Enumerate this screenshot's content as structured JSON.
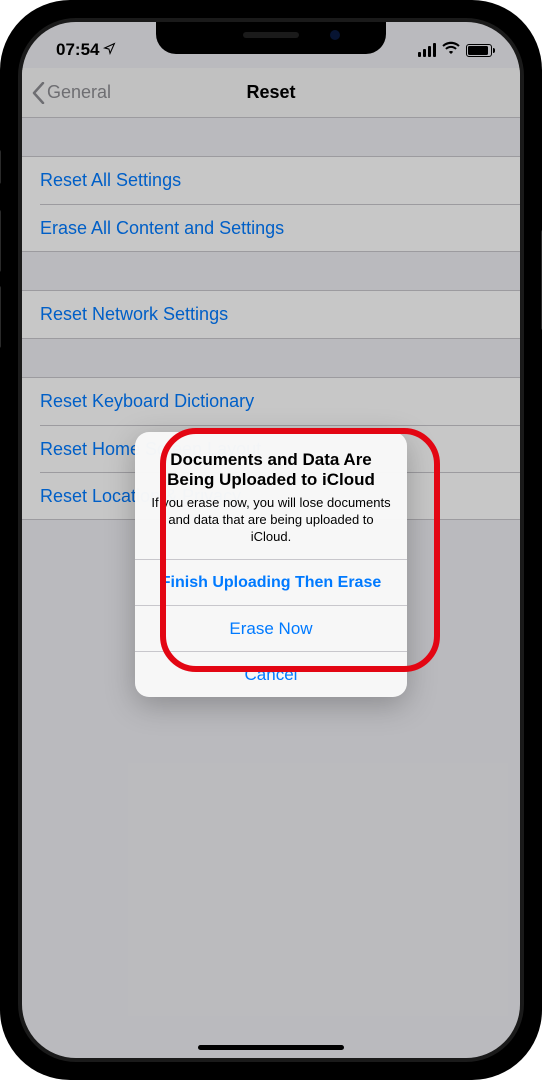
{
  "status": {
    "time": "07:54"
  },
  "nav": {
    "back_label": "General",
    "title": "Reset"
  },
  "groups": [
    {
      "rows": [
        "Reset All Settings",
        "Erase All Content and Settings"
      ]
    },
    {
      "rows": [
        "Reset Network Settings"
      ]
    },
    {
      "rows": [
        "Reset Keyboard Dictionary",
        "Reset Home Screen Layout",
        "Reset Location & Privacy"
      ]
    }
  ],
  "alert": {
    "title": "Documents and Data Are Being Uploaded to iCloud",
    "message": "If you erase now, you will lose documents and data that are being uploaded to iCloud.",
    "buttons": {
      "primary": "Finish Uploading Then Erase",
      "secondary": "Erase Now",
      "cancel": "Cancel"
    }
  }
}
